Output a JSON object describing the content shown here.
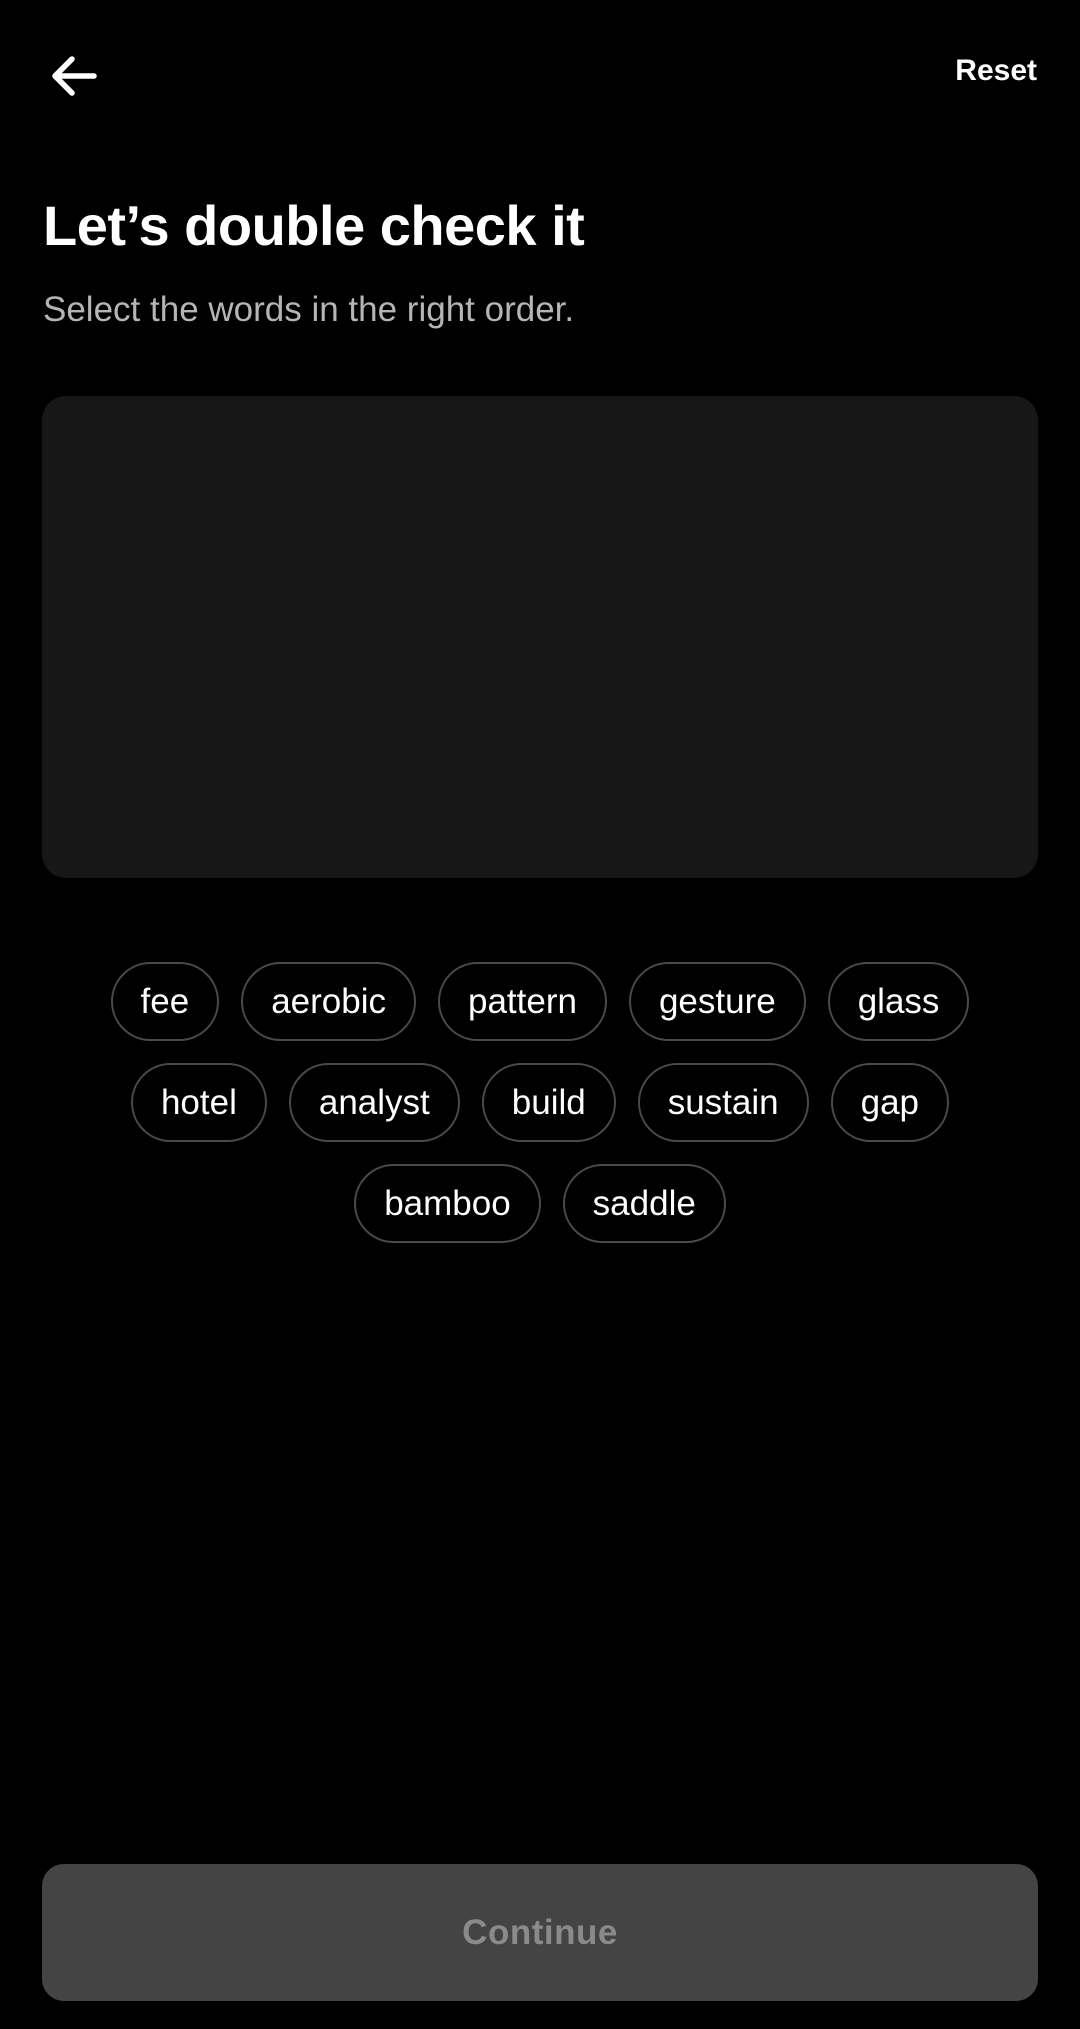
{
  "header": {
    "back_icon": "arrow-left-icon",
    "reset_label": "Reset"
  },
  "main": {
    "title": "Let’s double check it",
    "subtitle": "Select the words in the right order."
  },
  "selection_area": {
    "selected_words": []
  },
  "word_bank": {
    "rows": [
      [
        "fee",
        "aerobic",
        "pattern",
        "gesture",
        "glass"
      ],
      [
        "hotel",
        "analyst",
        "build",
        "sustain",
        "gap"
      ],
      [
        "bamboo",
        "saddle"
      ]
    ]
  },
  "footer": {
    "continue_label": "Continue",
    "continue_enabled": false
  },
  "colors": {
    "background": "#000000",
    "selection_area": "#171717",
    "chip_border": "#4a4a4a",
    "continue_disabled_bg": "#444444",
    "continue_disabled_text": "#8a8a8a",
    "subtitle": "#b5b5b5"
  }
}
